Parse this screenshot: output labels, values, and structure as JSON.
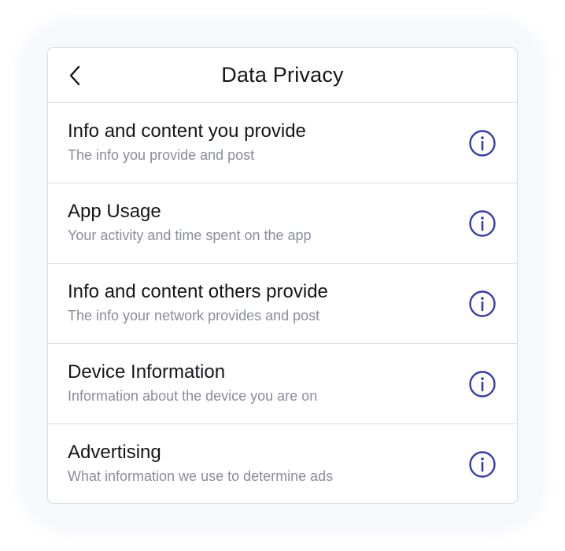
{
  "header": {
    "title": "Data Privacy",
    "back_icon": "chevron-left-icon"
  },
  "items": [
    {
      "title": "Info and content you provide",
      "subtitle": "The info you provide and post",
      "icon": "info-icon"
    },
    {
      "title": "App Usage",
      "subtitle": "Your activity and time spent on the app",
      "icon": "info-icon"
    },
    {
      "title": "Info and content others provide",
      "subtitle": "The info your network provides and post",
      "icon": "info-icon"
    },
    {
      "title": "Device Information",
      "subtitle": "Information about the device you are on",
      "icon": "info-icon"
    },
    {
      "title": "Advertising",
      "subtitle": "What information we use to determine ads",
      "icon": "info-icon"
    }
  ],
  "colors": {
    "accent": "#2f3bb8",
    "title_text": "#15151a",
    "subtitle_text": "#8a8c99",
    "divider": "#d9dbe1"
  }
}
